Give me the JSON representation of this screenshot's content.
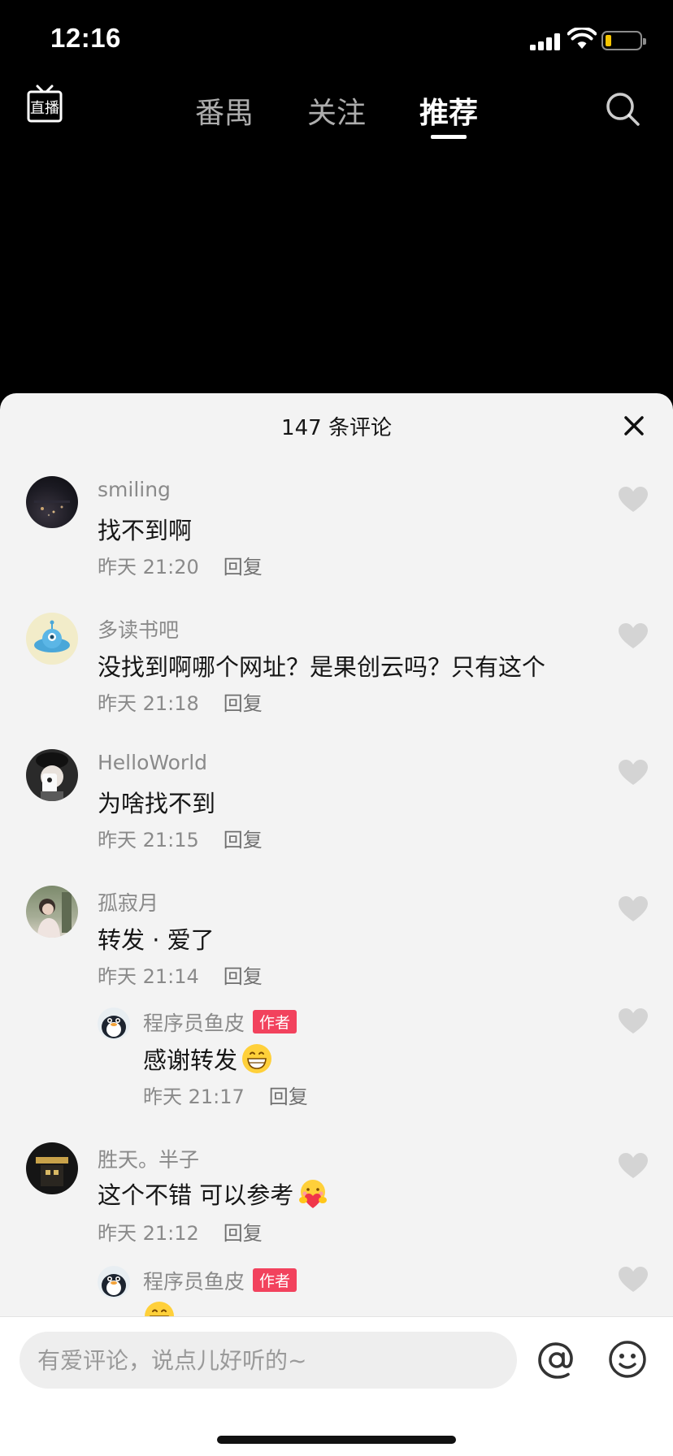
{
  "status_bar": {
    "time": "12:16",
    "battery_color": "#f5c400"
  },
  "top_nav": {
    "live_icon": "live-stream-icon",
    "tabs": [
      {
        "label": "番禺",
        "active": false
      },
      {
        "label": "关注",
        "active": false
      },
      {
        "label": "推荐",
        "active": true
      }
    ],
    "search_icon": "search-icon"
  },
  "comments_panel": {
    "title": "147 条评论",
    "close_icon": "close-icon",
    "comments": [
      {
        "username": "smiling",
        "content": "找不到啊",
        "time": "昨天 21:20",
        "reply_label": "回复"
      },
      {
        "username": "多读书吧",
        "content": "没找到啊哪个网址？是果创云吗？只有这个",
        "time": "昨天 21:18",
        "reply_label": "回复"
      },
      {
        "username": "HelloWorld",
        "content": "为啥找不到",
        "time": "昨天 21:15",
        "reply_label": "回复"
      },
      {
        "username": "孤寂月",
        "content": "转发 · 爱了",
        "time": "昨天 21:14",
        "reply_label": "回复"
      },
      {
        "username": "程序员鱼皮",
        "badge": "作者",
        "content": "感谢转发",
        "emoji": "grinning-emoji",
        "time": "昨天 21:17",
        "reply_label": "回复",
        "is_reply": true
      },
      {
        "username": "胜天。半子",
        "content": "这个不错 可以参考",
        "emoji": "heart-hug-emoji",
        "time": "昨天 21:12",
        "reply_label": "回复"
      },
      {
        "username": "程序员鱼皮",
        "badge": "作者",
        "emoji": "grinning-emoji",
        "is_reply": true
      }
    ]
  },
  "input_bar": {
    "placeholder": "有爱评论，说点儿好听的~",
    "at_icon": "at-icon",
    "emoji_icon": "emoji-icon"
  },
  "colors": {
    "author_badge": "#f2425d",
    "panel_bg": "#f3f3f3",
    "like_icon": "#d4d4d4"
  }
}
